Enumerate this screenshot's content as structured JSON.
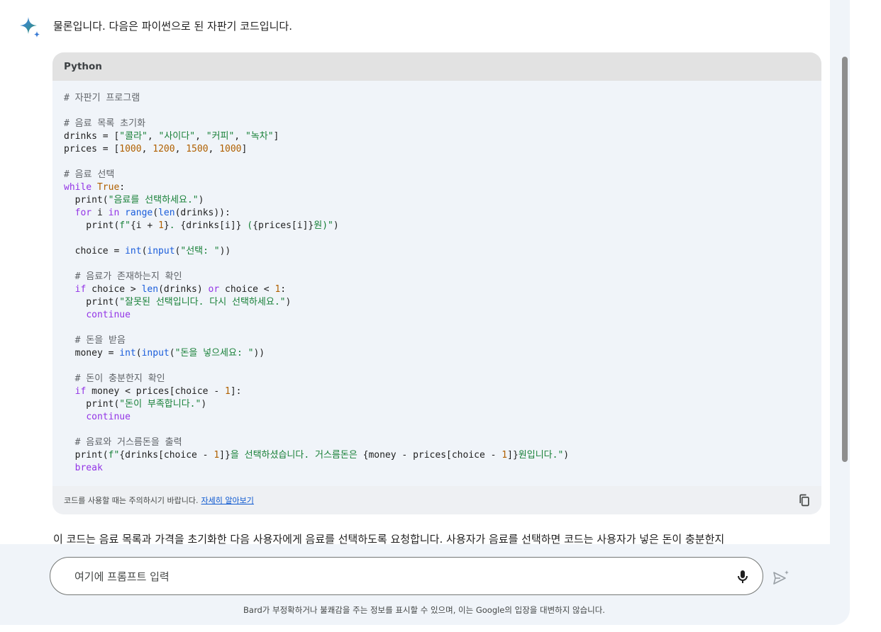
{
  "conversation": {
    "top_cut_text": "· · ·  · ·",
    "intro": "물론입니다. 다음은 파이썬으로 된 자판기 코드입니다.",
    "code_block": {
      "language": "Python",
      "footer_text": "코드를 사용할 때는 주의하시기 바랍니다.",
      "learn_more": "자세히 알아보기",
      "copy_icon": "copy-icon"
    },
    "answer_text": "이 코드는 음료 목록과 가격을 초기화한 다음 사용자에게 음료를 선택하도록 요청합니다. 사용자가 음료를 선택하면 코드는 사용자가 넣은 돈이 충분한지"
  },
  "input": {
    "placeholder": "여기에 프롬프트 입력",
    "value": ""
  },
  "icons": {
    "assistant": "sparkle-icon",
    "mic": "mic-icon",
    "send": "send-icon"
  },
  "disclaimer": "Bard가 부정확하거나 불쾌감을 주는 정보를 표시할 수 있으며, 이는 Google의 입장을 대변하지 않습니다.",
  "colors": {
    "accent": "#0b57d0",
    "page_bg": "#f0f4f9",
    "code_header": "#e2e2e2"
  }
}
